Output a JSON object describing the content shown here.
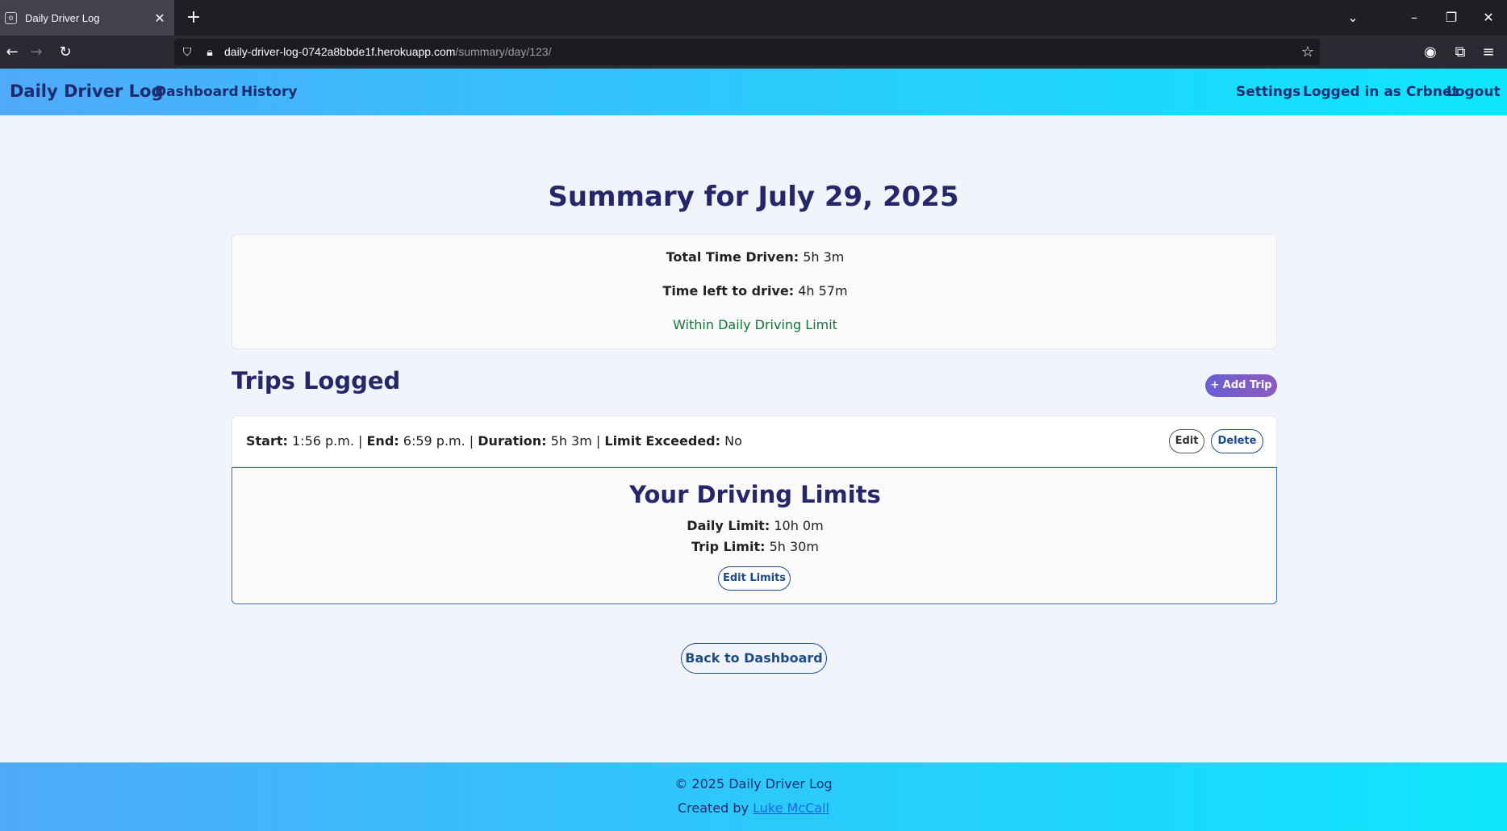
{
  "browser": {
    "tab_title": "Daily Driver Log",
    "url_host": "daily-driver-log-0742a8bbde1f.herokuapp.com",
    "url_path": "/summary/day/123/"
  },
  "header": {
    "brand": "Daily Driver Log",
    "nav_left": [
      "Dashboard",
      "History"
    ],
    "nav_right": [
      "Settings",
      "Logged in as Crbnet",
      "Logout"
    ]
  },
  "summary": {
    "title": "Summary for July 29, 2025",
    "total_label": "Total Time Driven:",
    "total_value": "5h 3m",
    "left_label": "Time left to drive:",
    "left_value": "4h 57m",
    "status": "Within Daily Driving Limit",
    "status_color": "#177237"
  },
  "trips": {
    "title": "Trips Logged",
    "add_label": "+ Add Trip",
    "rows": [
      {
        "start_label": "Start:",
        "start": "1:56 p.m.",
        "end_label": "End:",
        "end": "6:59 p.m.",
        "duration_label": "Duration:",
        "duration": "5h 3m",
        "exceeded_label": "Limit Exceeded:",
        "exceeded": "No",
        "edit_label": "Edit",
        "delete_label": "Delete"
      }
    ]
  },
  "limits": {
    "title": "Your Driving Limits",
    "daily_label": "Daily Limit:",
    "daily_value": "10h 0m",
    "trip_label": "Trip Limit:",
    "trip_value": "5h 30m",
    "edit_label": "Edit Limits"
  },
  "back_label": "Back to Dashboard",
  "footer": {
    "copyright": "© 2025 Daily Driver Log",
    "created_by": "Created by",
    "author": "Luke McCall"
  },
  "colors": {
    "header_gradient_start": "#4faaf9",
    "header_gradient_end": "#0ee6fd",
    "title_navy": "#26276a",
    "button_blue": "#1c4b8c",
    "add_trip_purple": "#6a5fd3"
  }
}
